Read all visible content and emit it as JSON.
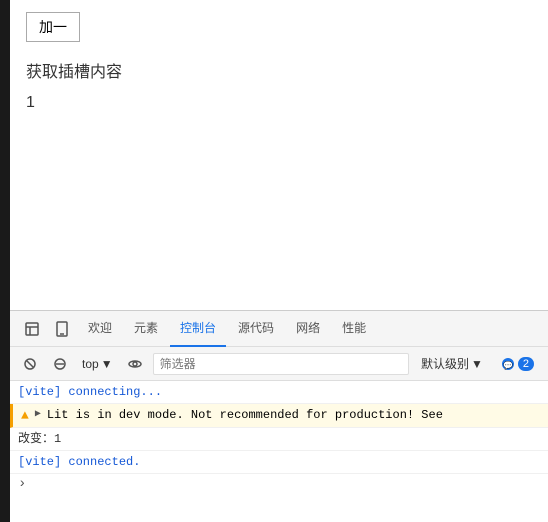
{
  "leftbar": {},
  "page": {
    "add_button_label": "加一",
    "slot_title": "获取插槽内容",
    "slot_value": "1"
  },
  "devtools": {
    "tabs": [
      {
        "id": "welcome",
        "label": "欢迎",
        "active": false
      },
      {
        "id": "elements",
        "label": "元素",
        "active": false
      },
      {
        "id": "console",
        "label": "控制台",
        "active": true
      },
      {
        "id": "sources",
        "label": "源代码",
        "active": false
      },
      {
        "id": "network",
        "label": "网络",
        "active": false
      },
      {
        "id": "performance",
        "label": "性能",
        "active": false
      }
    ],
    "toolbar": {
      "top_label": "top",
      "filter_placeholder": "筛选器",
      "level_label": "默认级别",
      "badge_count": "2"
    },
    "console_lines": [
      {
        "id": "vite-connecting",
        "type": "info",
        "text": "[vite] connecting..."
      },
      {
        "id": "lit-warning",
        "type": "warning",
        "text": "Lit is in dev mode. Not recommended for production! See"
      },
      {
        "id": "changed",
        "type": "changed",
        "text": "改变：1"
      },
      {
        "id": "vite-connected",
        "type": "vite-connected",
        "text": "[vite] connected."
      }
    ]
  }
}
